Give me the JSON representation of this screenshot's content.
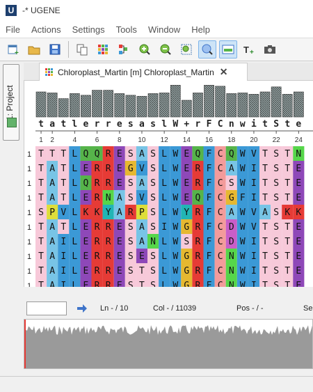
{
  "window": {
    "title": "-* UGENE",
    "logo_letter": "U"
  },
  "menu": [
    "File",
    "Actions",
    "Settings",
    "Tools",
    "Window",
    "Help"
  ],
  "toolbar": {
    "icons": [
      "new-project-icon",
      "open-folder-icon",
      "save-icon",
      "copy-icon",
      "grid-icon",
      "tree-icon",
      "zoom-in-icon",
      "zoom-out-icon",
      "zoom-fit-icon",
      "zoom-reset-icon",
      "overview-icon",
      "add-text-icon",
      "camera-icon"
    ],
    "active_icons": [
      "zoom-reset-icon",
      "overview-icon"
    ]
  },
  "side_panel": {
    "project_tab_label": "1: Project"
  },
  "document_tab": {
    "label": "Chloroplast_Martin [m] Chloroplast_Martin"
  },
  "alignment": {
    "consensus_letters": [
      "t",
      "a",
      "t",
      "l",
      "e",
      "r",
      "r",
      "e",
      "s",
      "a",
      "s",
      "l",
      "W",
      "+",
      "r",
      "F",
      "C",
      "n",
      "w",
      "i",
      "t",
      "S",
      "t",
      "e"
    ],
    "consensus_heights": [
      0.75,
      0.72,
      0.55,
      0.7,
      0.65,
      0.8,
      0.8,
      0.7,
      0.65,
      0.62,
      0.7,
      0.72,
      0.95,
      0.5,
      0.72,
      0.95,
      0.92,
      0.7,
      0.72,
      0.68,
      0.75,
      0.9,
      0.68,
      0.75
    ],
    "ruler_numbers": [
      "1",
      "2",
      "4",
      "6",
      "8",
      "10",
      "12",
      "14",
      "16",
      "18",
      "20",
      "22",
      "24"
    ],
    "ruler_positions": [
      1,
      2,
      4,
      6,
      8,
      10,
      12,
      14,
      16,
      18,
      20,
      22,
      24
    ],
    "row_indicator": "1",
    "rows": [
      "TTTLQQRESASLWEQFCQWVTSTN",
      "TATLERREGVSLWERFCAWITSTE",
      "TATLQRRESASLWERFCSWITSTE",
      "TATLERNASVSLWEQFCGFITSTE",
      "SPVLKKYARPSLWYRFCAWVASKK",
      "TATLERRESASIWGRFCDWVTSTE",
      "TAILERRESANLWSRFCDWITSTE",
      "TAILERRESESLWGRFCNWITSTE",
      "TAILERRESTSLWGRFCNWITSTE",
      "TAILERRESTSLWGRFCNWITSTE"
    ]
  },
  "residue_colors": {
    "T": "#f7c9d9",
    "A": "#78c4e6",
    "S": "#f7c9d9",
    "L": "#3b99d6",
    "I": "#3b99d6",
    "V": "#3b99d6",
    "Q": "#56b44a",
    "E": "#8e48b8",
    "R": "#e63b36",
    "K": "#e63b36",
    "N": "#56d64a",
    "G": "#e6b830",
    "W": "#3b99d6",
    "F": "#3b99d6",
    "C": "#f39b9b",
    "Y": "#21b5b5",
    "P": "#dede3a",
    "D": "#c85ec8"
  },
  "column_backgrounds": [
    "#f7c9d9",
    "#78c4e6",
    "#f7c9d9",
    "#3b99d6",
    "#c8c8c8",
    "#c8b43a",
    "#c8b43a",
    "#c8c8c8",
    "#f7c9d9",
    "#78c4e6",
    "#f7c9d9",
    "#3b99d6",
    "#3bc8a0",
    "#c8c8c8",
    "#e6b830",
    "#3b99d6",
    "#6a40d6",
    "#c8c8c8",
    "#3b99d6",
    "#c8c8c8",
    "#f7c9d9",
    "#f7c9d9",
    "#f7c9d9",
    "#c8c8c8"
  ],
  "status": {
    "ln": "Ln - / 10",
    "col": "Col - / 11039",
    "pos": "Pos - / -",
    "sel": "Se"
  }
}
